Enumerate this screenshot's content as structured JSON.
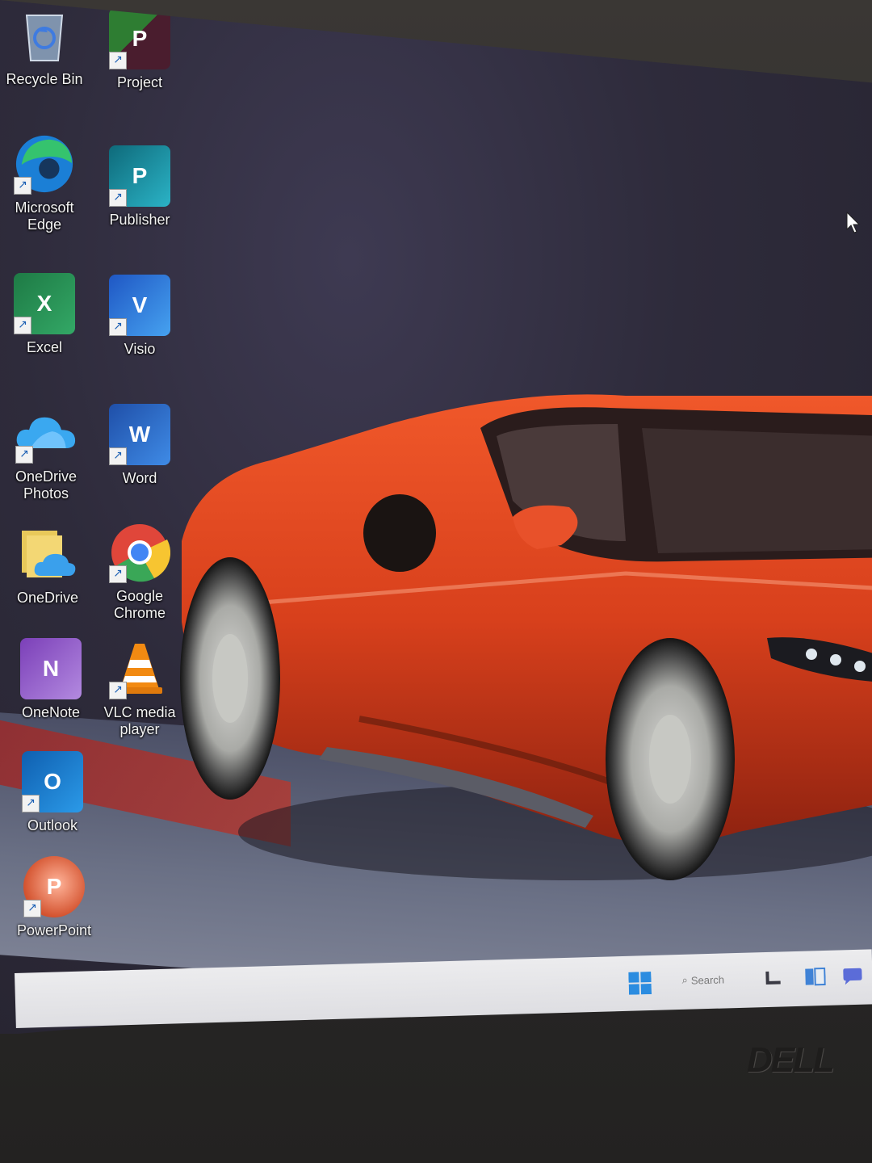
{
  "desktop": {
    "icons": [
      {
        "label": "Recycle Bin",
        "icon": "recycle-bin-icon"
      },
      {
        "label": "Project",
        "icon": "project-icon"
      },
      {
        "label": "Microsoft Edge",
        "icon": "edge-icon"
      },
      {
        "label": "Publisher",
        "icon": "publisher-icon"
      },
      {
        "label": "Excel",
        "icon": "excel-icon"
      },
      {
        "label": "Visio",
        "icon": "visio-icon"
      },
      {
        "label": "OneDrive Photos",
        "icon": "onedrive-photos-icon"
      },
      {
        "label": "Word",
        "icon": "word-icon"
      },
      {
        "label": "OneDrive",
        "icon": "onedrive-folder-icon"
      },
      {
        "label": "Google Chrome",
        "icon": "chrome-icon"
      },
      {
        "label": "OneNote",
        "icon": "onenote-icon"
      },
      {
        "label": "VLC media player",
        "icon": "vlc-icon"
      },
      {
        "label": "Outlook",
        "icon": "outlook-icon"
      },
      {
        "label": "PowerPoint",
        "icon": "powerpoint-icon"
      }
    ],
    "glyph_letters": {
      "project": "P",
      "publisher": "P",
      "excel": "X",
      "visio": "V",
      "word": "W",
      "onenote": "N",
      "outlook": "O",
      "powerpoint": "P"
    },
    "shortcut_arrow": "↗"
  },
  "taskbar": {
    "search_placeholder": "Search",
    "items": [
      "start-button",
      "search-box",
      "widgets-icon",
      "task-view-icon",
      "chat-icon"
    ]
  },
  "hardware": {
    "brand_logo": "DELL"
  },
  "colors": {
    "car_red": "#d8401c",
    "wallpaper_bg": "#2e2b3b",
    "taskbar_bg": "#e6e6ea",
    "excel_green": "#1e7a45",
    "word_blue": "#2b64c8",
    "visio_blue": "#2f6fd8",
    "publisher_teal": "#1f8a9b",
    "project_green": "#2e7d32",
    "onenote_purple": "#7b3fb8",
    "outlook_blue": "#1a73c8",
    "powerpoint_orange": "#d3522e"
  }
}
